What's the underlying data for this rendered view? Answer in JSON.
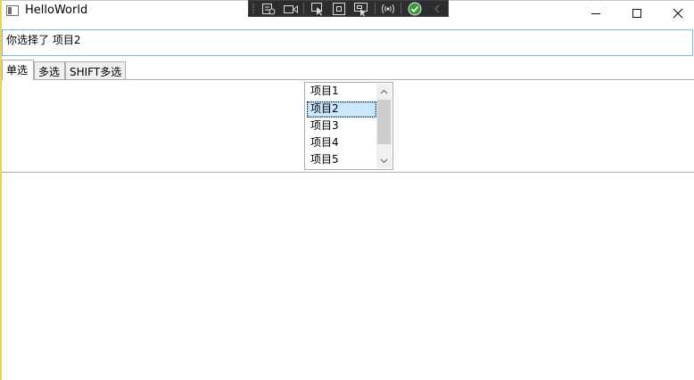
{
  "window": {
    "title": "HelloWorld",
    "minimize_glyph": "—",
    "maximize_glyph": "☐",
    "close_glyph": "✕"
  },
  "debug_toolbar": {
    "buttons": [
      "live-visual-tree-icon",
      "record-icon",
      "select-element-icon",
      "display-layout-adorners-icon",
      "track-focus-icon",
      "hot-reload-icon",
      "status-ok-icon",
      "collapse-icon"
    ]
  },
  "status": {
    "text": "你选择了 项目2"
  },
  "tabs": [
    {
      "label": "单选",
      "selected": true
    },
    {
      "label": "多选",
      "selected": false
    },
    {
      "label": "SHIFT多选",
      "selected": false
    }
  ],
  "listbox": {
    "items": [
      "项目1",
      "项目2",
      "项目3",
      "项目4",
      "项目5"
    ],
    "selected_index": 1
  },
  "colors": {
    "accent_border": "#7eb4ea",
    "selection_bg": "#cce8ff",
    "frame_left": "#e8d44d",
    "toolbar_bg": "#2d2d30"
  }
}
